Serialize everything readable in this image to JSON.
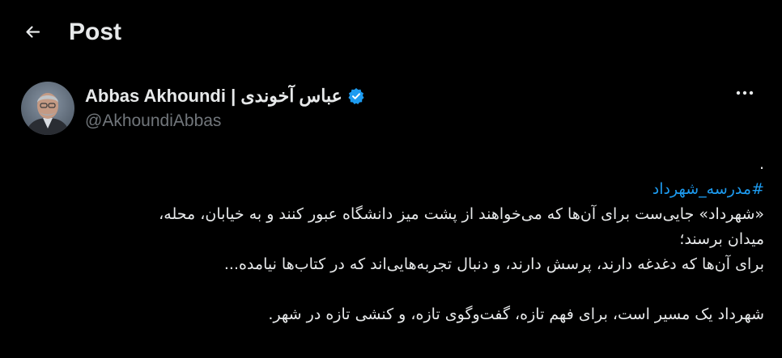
{
  "header": {
    "title": "Post",
    "back_icon": "arrow-left-icon"
  },
  "author": {
    "display_name": "Abbas Akhoundi | عباس آخوندی",
    "handle": "@AkhoundiAbbas",
    "verified_icon": "verified-badge-icon",
    "avatar_icon": "avatar-portrait"
  },
  "more_icon": "more-horizontal-icon",
  "tweet": {
    "lines": [
      ".",
      "#مدرسه_شهرداد",
      "«شهرداد» جایی‌ست برای آن‌ها که می‌خواهند از پشت میز دانشگاه عبور کنند و به خیابان، محله،",
      "میدان برسند؛",
      "برای آن‌ها که دغدغه دارند، پرسش دارند، و دنبال تجربه‌هایی‌اند که در کتاب‌ها نیامده...",
      "",
      "شهرداد یک مسیر است، برای فهم تازه، گفت‌وگوی تازه، و کنشی تازه در شهر."
    ]
  },
  "colors": {
    "background": "#000000",
    "text": "#e7e9ea",
    "secondary": "#71767b",
    "accent": "#1d9bf0"
  }
}
